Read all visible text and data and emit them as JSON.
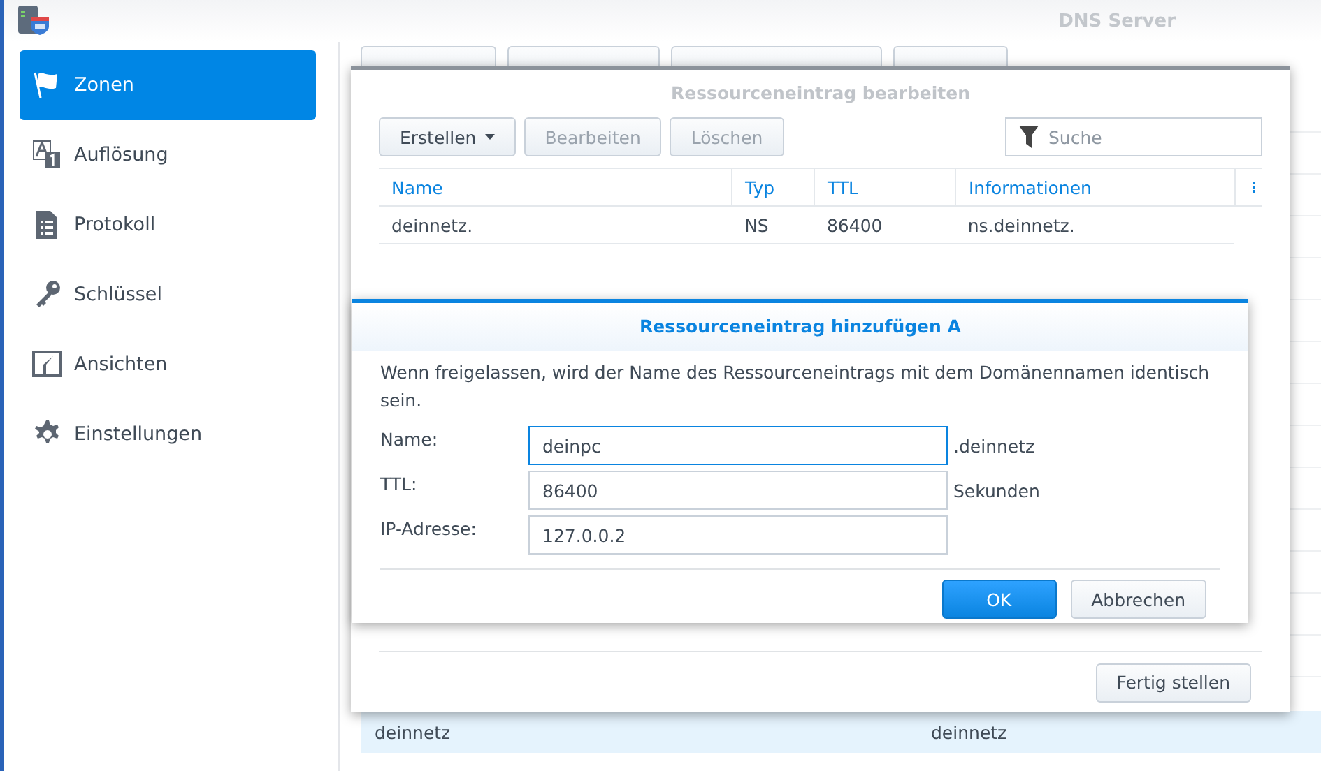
{
  "window": {
    "title": "DNS Server"
  },
  "sidebar": {
    "items": [
      {
        "label": "Zonen",
        "selected": true
      },
      {
        "label": "Auflösung",
        "selected": false
      },
      {
        "label": "Protokoll",
        "selected": false
      },
      {
        "label": "Schlüssel",
        "selected": false
      },
      {
        "label": "Ansichten",
        "selected": false
      },
      {
        "label": "Einstellungen",
        "selected": false
      }
    ]
  },
  "zones": {
    "rows": [
      {
        "column_1": "deinnetz",
        "column_2": "deinnetz",
        "selected": true
      }
    ]
  },
  "edit_dialog": {
    "title": "Ressourceneintrag bearbeiten",
    "toolbar": [
      {
        "label": "Erstellen",
        "menu": true,
        "disabled": false
      },
      {
        "label": "Bearbeiten",
        "menu": false,
        "disabled": true
      },
      {
        "label": "Löschen",
        "menu": false,
        "disabled": true
      }
    ],
    "search": {
      "placeholder": "Suche"
    },
    "columns": [
      "Name",
      "Typ",
      "TTL",
      "Informationen"
    ],
    "rows": [
      {
        "cells": [
          "deinnetz.",
          "NS",
          "86400",
          "ns.deinnetz."
        ]
      }
    ],
    "done_button": "Fertig stellen"
  },
  "add_dialog": {
    "title": "Ressourceneintrag hinzufügen A",
    "description": "Wenn freigelassen, wird der Name des Ressourceneintrags mit dem Domänennamen identisch sein.",
    "fields": [
      {
        "label": "Name:",
        "value": "deinpc",
        "suffix": ".deinnetz",
        "focused": true
      },
      {
        "label": "TTL:",
        "value": "86400",
        "suffix": "Sekunden",
        "focused": false
      },
      {
        "label": "IP-Adresse:",
        "value": "127.0.0.2",
        "focused": false
      }
    ],
    "buttons": [
      {
        "label": "OK",
        "primary": true
      },
      {
        "label": "Abbrechen",
        "primary": false
      }
    ]
  }
}
